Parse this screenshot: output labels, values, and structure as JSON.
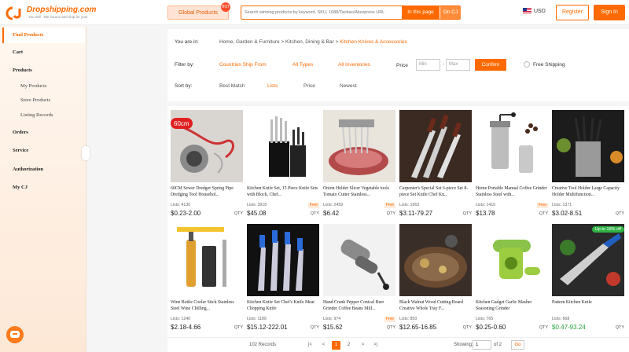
{
  "header": {
    "logo_name": "Dropshipping.com",
    "logo_tagline": "You sell - We source and ship for you!",
    "global_products": "Global Products",
    "global_badge": "HOT",
    "search_placeholder": "Search winning products by keyword, SKU, 1688/Taobao/Aliexpress URL",
    "search_in_page": "In this page",
    "search_on_cj": "On CJ",
    "currency": "USD",
    "register": "Register",
    "sign_in": "Sign In"
  },
  "sidebar": {
    "find_products": "Find Products",
    "cart": "Cart",
    "products": "Products",
    "my_products": "My Products",
    "store_products": "Store Products",
    "listing_records": "Listing Records",
    "orders": "Orders",
    "service": "Service",
    "authorization": "Authorization",
    "my_cj": "My CJ",
    "contact_agent": "Contact Agent"
  },
  "filters": {
    "you_are_in_label": "You are in:",
    "breadcrumb": [
      "Home, Garden & Furniture >",
      "Kitchen, Dining & Bar >",
      "Kitchen Knives & Accessories"
    ],
    "filter_by_label": "Filter by:",
    "countries": "Countries Ship From",
    "all_types": "All Types",
    "all_inventories": "All Inventories",
    "price_label": "Price",
    "min_placeholder": "Min",
    "max_placeholder": "Max",
    "confirm": "Confirm",
    "free_shipping": "Free Shipping",
    "sort_by_label": "Sort by:",
    "sort_options": [
      "Best Match",
      "Lists",
      "Price",
      "Newest"
    ]
  },
  "products": [
    {
      "title": "60CM Sewer Dredger Spring Pipe Dredging Tool Househol...",
      "lists": "Lists: 4130",
      "price": "$0.23-2.00",
      "qty": "QTY",
      "free": "",
      "img": "dredger"
    },
    {
      "title": "Kitchen Knife Set, 15 Piece Knife Sets with Block, Chef...",
      "lists": "Lists: 3918",
      "price": "$45.08",
      "qty": "QTY",
      "free": "Free",
      "img": "knifeblock"
    },
    {
      "title": "Onion Holder Slicer Vegetable tools Tomato Cutter Stainless...",
      "lists": "Lists: 2459",
      "price": "$6.42",
      "qty": "QTY",
      "free": "Free",
      "img": "onion"
    },
    {
      "title": "Carpenter's Special Set 6-piece Set 8-piece Set Knife Chef Kn...",
      "lists": "Lists: 1963",
      "price": "$3.11-79.27",
      "qty": "QTY",
      "free": "",
      "img": "knives"
    },
    {
      "title": "Home Portable Manual Coffee Grinder Stainless Steel with...",
      "lists": "Lists: 1416",
      "price": "$13.78",
      "qty": "QTY",
      "free": "Free",
      "img": "grinder"
    },
    {
      "title": "Creative Tool Holder Large Capacity Holder Multifunction...",
      "lists": "Lists: 1371",
      "price": "$3.02-8.51",
      "qty": "QTY",
      "free": "",
      "img": "holder"
    },
    {
      "title": "Wine Bottle Cooler Stick Stainless Steel Wine Chilling...",
      "lists": "Lists: 1240",
      "price": "$2.18-4.66",
      "qty": "QTY",
      "free": "",
      "img": "wine"
    },
    {
      "title": "Kitchen Knife Set Chef's Knife Meat Chopping Knife",
      "lists": "Lists: 1189",
      "price": "$15.12-222.01",
      "qty": "QTY",
      "free": "",
      "img": "knifeset2"
    },
    {
      "title": "Hand Crank Pepper Conical Burr Grinder Coffee Beans Mill...",
      "lists": "Lists: 974",
      "price": "$15.62",
      "qty": "QTY",
      "free": "Free",
      "img": "pepper"
    },
    {
      "title": "Black Walnut Wood Cutting Board Creative Whole Tray F...",
      "lists": "Lists: 850",
      "price": "$12.65-16.85",
      "qty": "QTY",
      "free": "",
      "img": "board"
    },
    {
      "title": "Kitchen Gadget Garlic Masher Seasoning Grinder",
      "lists": "Lists: 765",
      "price": "$0.25-0.60",
      "qty": "QTY",
      "free": "",
      "img": "garlic"
    },
    {
      "title": "Pattern Kitchen Knife",
      "lists": "Lists: 668",
      "price": "$0.47-93.24",
      "qty": "QTY",
      "free": "",
      "img": "pattern",
      "promo": "Up to 19% off"
    }
  ],
  "pager": {
    "records": "102 Records",
    "first": "|<",
    "prev": "<",
    "pages": [
      "1",
      "2"
    ],
    "next": ">",
    "last": ">|",
    "showing": "Showing:",
    "page_value": "1",
    "of": "of 2",
    "go": "Go"
  }
}
